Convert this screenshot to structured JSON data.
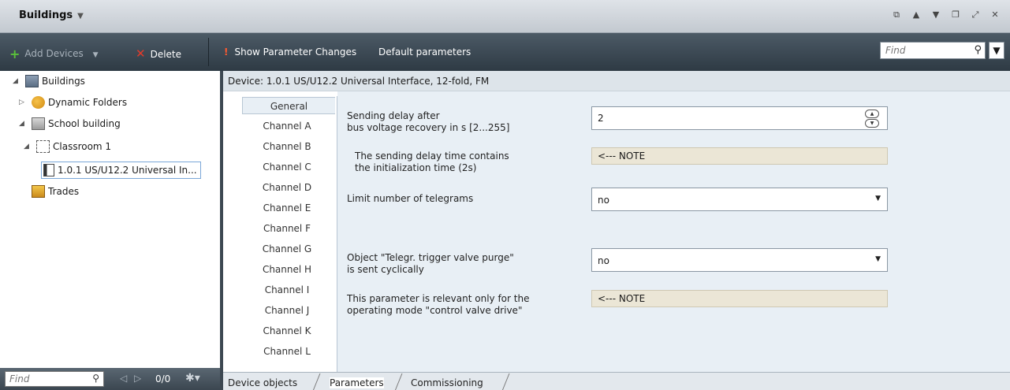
{
  "window": {
    "title": "Buildings",
    "title_caret": "▼",
    "controls": [
      "⧉",
      "▲",
      "▼",
      "❐",
      "⤢",
      "✕"
    ]
  },
  "toolbar": {
    "add_devices_label": "Add Devices",
    "add_devices_caret": "▼",
    "delete_label": "Delete",
    "show_param_changes_label": "Show Parameter Changes",
    "default_params_label": "Default parameters",
    "find_placeholder": "Find"
  },
  "tree": {
    "items": [
      {
        "label": "Buildings",
        "icon": "building-icon"
      },
      {
        "label": "Dynamic Folders",
        "icon": "dynamic-folder-icon"
      },
      {
        "label": "School building",
        "icon": "school-building-icon"
      },
      {
        "label": "Classroom 1",
        "icon": "room-icon"
      },
      {
        "label": "1.0.1  US/U12.2 Universal In...",
        "icon": "device-icon"
      },
      {
        "label": "Trades",
        "icon": "trades-icon"
      }
    ],
    "footer": {
      "find_placeholder": "Find",
      "count": "0/0"
    }
  },
  "device": {
    "header": "Device: 1.0.1  US/U12.2 Universal Interface, 12-fold, FM"
  },
  "channels": [
    "General",
    "Channel A",
    "Channel B",
    "Channel C",
    "Channel D",
    "Channel E",
    "Channel F",
    "Channel G",
    "Channel H",
    "Channel I",
    "Channel J",
    "Channel K",
    "Channel L"
  ],
  "params": {
    "p1_line1": "Sending delay after",
    "p1_line2": "bus voltage recovery in s [2...255]",
    "p1_value": "2",
    "p2_line1": "The sending delay time contains",
    "p2_line2": "the initialization time (2s)",
    "p2_note": "<--- NOTE",
    "p3_label": "Limit number of telegrams",
    "p3_value": "no",
    "p4_line1": "Object \"Telegr. trigger valve purge\"",
    "p4_line2": "is sent cyclically",
    "p4_value": "no",
    "p5_line1": "This parameter is relevant only for the",
    "p5_line2": "operating mode \"control valve drive\"",
    "p5_note": "<--- NOTE"
  },
  "bottom_tabs": [
    "Device objects",
    "Parameters",
    "Commissioning"
  ],
  "colors": {
    "toolbar_bg": "#3a4650",
    "param_bg": "#e8eff5",
    "note_bg": "#ebe6d6",
    "accent_add": "#5ac23a",
    "accent_delete": "#e43b2a"
  }
}
